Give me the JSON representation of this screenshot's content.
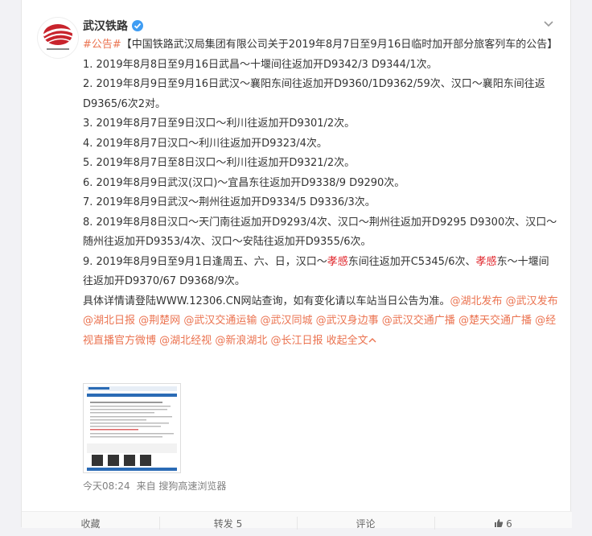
{
  "post": {
    "author": "武汉铁路",
    "logo_text": "武汉铁路局",
    "more_icon": "chevron-down-icon",
    "text": {
      "hashtag": "#公告#",
      "headline": "【中国铁路武汉局集团有限公司关于2019年8月7日至9月16日临时加开部分旅客列车的公告】",
      "items": [
        "1. 2019年8月8日至9月16日武昌～十堰间往返加开D9342/3 D9344/1次。",
        "2. 2019年8月9日至9月16日武汉～襄阳东间往返加开D9360/1D9362/59次、汉口～襄阳东间往返D9365/6次2对。",
        "3. 2019年8月7日至9日汉口～利川往返加开D9301/2次。",
        "4. 2019年8月7日汉口～利川往返加开D9323/4次。",
        "5. 2019年8月7日至8日汉口～利川往返加开D9321/2次。",
        "6. 2019年8月9日武汉(汉口)～宜昌东往返加开D9338/9 D9290次。",
        "7. 2019年8月9日武汉～荆州往返加开D9334/5 D9336/3次。",
        "8. 2019年8月8日汉口～天门南往返加开D9293/4次、汉口～荆州往返加开D9295 D9300次、汉口～随州往返加开D9353/4次、汉口～安陆往返加开D9355/6次。"
      ],
      "item9": {
        "p1": "9. 2019年8月9日至9月1日逢周五、六、日，汉口～",
        "hl1": "孝感",
        "p2": "东间往返加开C5345/6次、",
        "hl2": "孝感",
        "p3": "东～十堰间往返加开D9370/67 D9368/9次。"
      },
      "closing": "具体详情请登陆WWW.12306.CN网站查询，如有变化请以车站当日公告为准。",
      "mentions": [
        "@湖北发布",
        "@武汉发布",
        "@湖北日报",
        "@荆楚网",
        "@武汉交通运输",
        "@武汉同城",
        "@武汉身边事",
        "@武汉交通广播",
        "@楚天交通广播",
        "@经视直播官方微博",
        "@湖北经视",
        "@新浪湖北",
        "@长江日报"
      ],
      "expand_label": "收起全文"
    },
    "time": "今天08:24",
    "source": "来自 搜狗高速浏览器"
  },
  "actions": {
    "favorite": "收藏",
    "repost": "转发 5",
    "comment": "评论",
    "like_count": "6",
    "like_icon": "thumbs-up-icon"
  },
  "colors": {
    "link": "#eb7350",
    "highlight": "#e0242a",
    "background": "#f2f2f5"
  }
}
